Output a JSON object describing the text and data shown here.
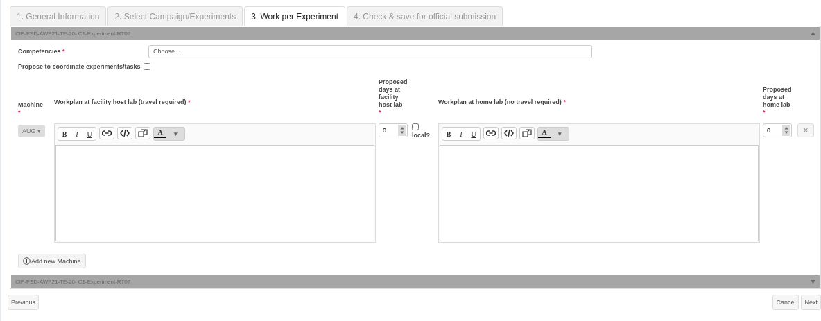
{
  "tabs": [
    {
      "label": "1. General Information",
      "selected": false
    },
    {
      "label": "2. Select Campaign/Experiments",
      "selected": false
    },
    {
      "label": "3. Work per Experiment",
      "selected": true
    },
    {
      "label": "4. Check & save for official submission",
      "selected": false
    }
  ],
  "sections": [
    {
      "title": "CIP-FSD-AWP21-TE-20- C1-Experiment-RT02",
      "expanded": true
    },
    {
      "title": "CIP-FSD-AWP21-TE-20- C1-Experiment-RT07",
      "expanded": false
    }
  ],
  "competencies": {
    "label": "Competencies",
    "required_mark": "*",
    "placeholder": "Choose..."
  },
  "coordinate": {
    "label": "Propose to coordinate experiments/tasks",
    "checked": false
  },
  "columns": [
    {
      "label": "Machine",
      "required_mark": "*",
      "kind": "stacked"
    },
    {
      "label": "Workplan at facility host lab (travel required)",
      "required_mark": "*",
      "kind": "inline"
    },
    {
      "label": "Proposed days at facility host lab",
      "required_mark": "*",
      "kind": "stacked"
    },
    {
      "label": "Workplan at home lab (no travel required)",
      "required_mark": "*",
      "kind": "inline"
    },
    {
      "label": "Proposed days at home lab",
      "required_mark": "*",
      "kind": "stacked"
    }
  ],
  "editors": [
    {
      "toolbar": [
        {
          "kind": "bold",
          "label": "B"
        },
        {
          "kind": "italic",
          "label": "I"
        },
        {
          "kind": "underline",
          "label": "U"
        },
        {
          "kind": "link"
        },
        {
          "kind": "code"
        },
        {
          "kind": "popout"
        },
        {
          "kind": "color",
          "label": "A"
        },
        {
          "kind": "caret",
          "label": "▾"
        }
      ]
    },
    {
      "toolbar": [
        {
          "kind": "bold",
          "label": "B"
        },
        {
          "kind": "italic",
          "label": "I"
        },
        {
          "kind": "underline",
          "label": "U"
        },
        {
          "kind": "link"
        },
        {
          "kind": "code"
        },
        {
          "kind": "popout"
        },
        {
          "kind": "color",
          "label": "A"
        },
        {
          "kind": "caret",
          "label": "▾"
        }
      ]
    }
  ],
  "machine_row": {
    "machine": "AUG ▾",
    "host_days": "0",
    "local": {
      "label": "local?",
      "checked": false
    },
    "home_days": "0",
    "remove": "×"
  },
  "add_machine": "Add new Machine",
  "footer": {
    "previous": "Previous",
    "cancel": "Cancel",
    "next": "Next"
  }
}
